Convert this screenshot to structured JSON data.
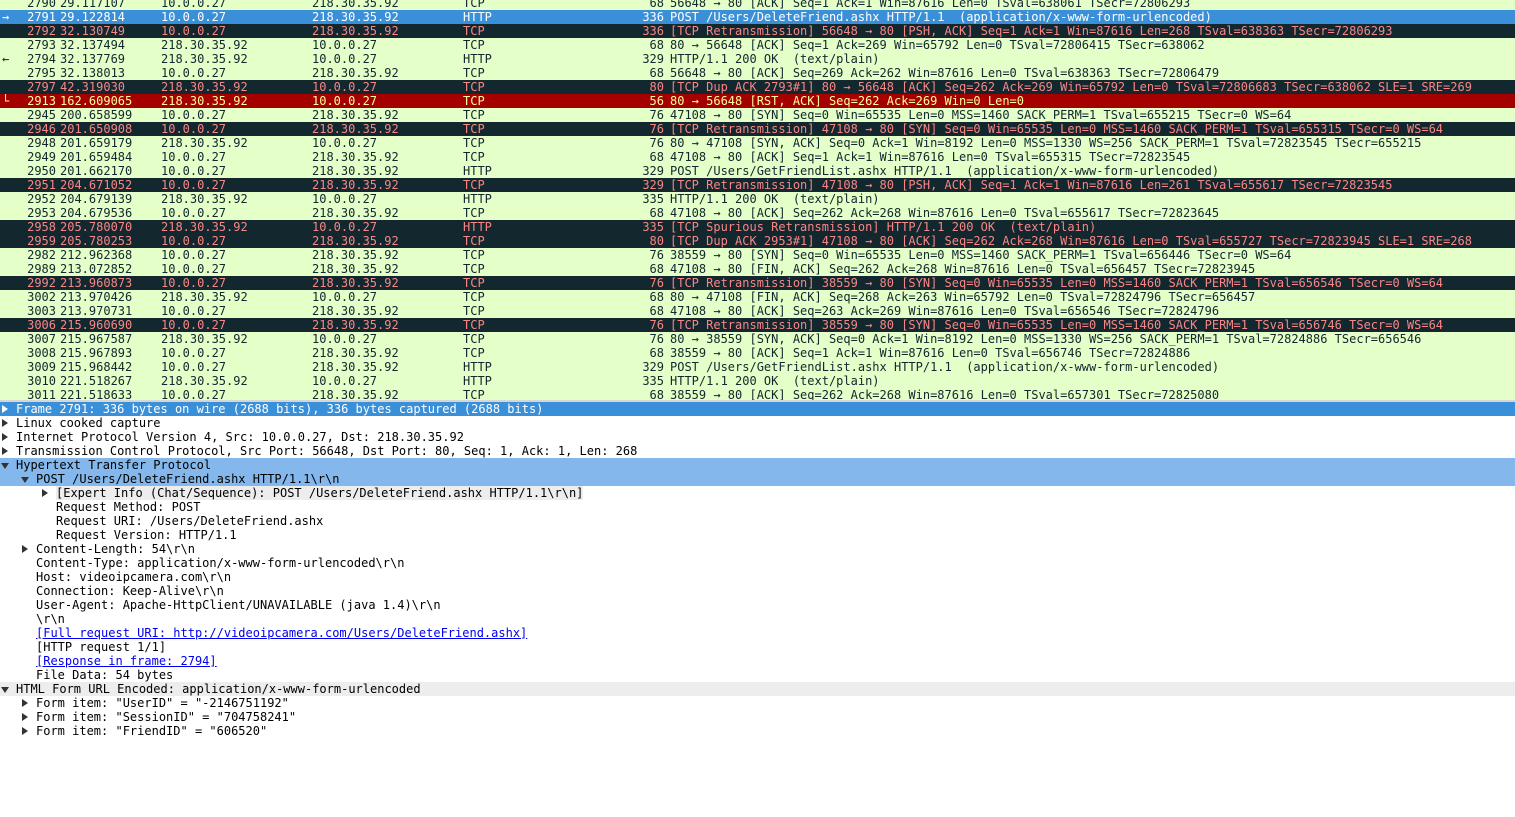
{
  "packets": [
    {
      "no": "2790",
      "time": "29.117107",
      "src": "10.0.0.27",
      "dst": "218.30.35.92",
      "proto": "TCP",
      "len": "68",
      "info": "56648 → 80 [ACK] Seq=1 Ack=1 Win=87616 Len=0 TSval=638061 TSecr=72806293",
      "style": "normal",
      "marker": ""
    },
    {
      "no": "2791",
      "time": "29.122814",
      "src": "10.0.0.27",
      "dst": "218.30.35.92",
      "proto": "HTTP",
      "len": "336",
      "info": "POST /Users/DeleteFriend.ashx HTTP/1.1  (application/x-www-form-urlencoded)",
      "style": "selected",
      "marker": "→"
    },
    {
      "no": "2792",
      "time": "32.130749",
      "src": "10.0.0.27",
      "dst": "218.30.35.92",
      "proto": "TCP",
      "len": "336",
      "info": "[TCP Retransmission] 56648 → 80 [PSH, ACK] Seq=1 Ack=1 Win=87616 Len=268 TSval=638363 TSecr=72806293",
      "style": "bad",
      "marker": ""
    },
    {
      "no": "2793",
      "time": "32.137494",
      "src": "218.30.35.92",
      "dst": "10.0.0.27",
      "proto": "TCP",
      "len": "68",
      "info": "80 → 56648 [ACK] Seq=1 Ack=269 Win=65792 Len=0 TSval=72806415 TSecr=638062",
      "style": "normal",
      "marker": ""
    },
    {
      "no": "2794",
      "time": "32.137769",
      "src": "218.30.35.92",
      "dst": "10.0.0.27",
      "proto": "HTTP",
      "len": "329",
      "info": "HTTP/1.1 200 OK  (text/plain)",
      "style": "normal",
      "marker": "←"
    },
    {
      "no": "2795",
      "time": "32.138013",
      "src": "10.0.0.27",
      "dst": "218.30.35.92",
      "proto": "TCP",
      "len": "68",
      "info": "56648 → 80 [ACK] Seq=269 Ack=262 Win=87616 Len=0 TSval=638363 TSecr=72806479",
      "style": "normal",
      "marker": ""
    },
    {
      "no": "2797",
      "time": "42.319030",
      "src": "218.30.35.92",
      "dst": "10.0.0.27",
      "proto": "TCP",
      "len": "80",
      "info": "[TCP Dup ACK 2793#1] 80 → 56648 [ACK] Seq=262 Ack=269 Win=65792 Len=0 TSval=72806683 TSecr=638062 SLE=1 SRE=269",
      "style": "bad",
      "marker": ""
    },
    {
      "no": "2913",
      "time": "162.609065",
      "src": "218.30.35.92",
      "dst": "10.0.0.27",
      "proto": "TCP",
      "len": "56",
      "info": "80 → 56648 [RST, ACK] Seq=262 Ack=269 Win=0 Len=0",
      "style": "rst",
      "marker": "└"
    },
    {
      "no": "2945",
      "time": "200.658599",
      "src": "10.0.0.27",
      "dst": "218.30.35.92",
      "proto": "TCP",
      "len": "76",
      "info": "47108 → 80 [SYN] Seq=0 Win=65535 Len=0 MSS=1460 SACK_PERM=1 TSval=655215 TSecr=0 WS=64",
      "style": "normal",
      "marker": ""
    },
    {
      "no": "2946",
      "time": "201.650908",
      "src": "10.0.0.27",
      "dst": "218.30.35.92",
      "proto": "TCP",
      "len": "76",
      "info": "[TCP Retransmission] 47108 → 80 [SYN] Seq=0 Win=65535 Len=0 MSS=1460 SACK_PERM=1 TSval=655315 TSecr=0 WS=64",
      "style": "bad",
      "marker": ""
    },
    {
      "no": "2948",
      "time": "201.659179",
      "src": "218.30.35.92",
      "dst": "10.0.0.27",
      "proto": "TCP",
      "len": "76",
      "info": "80 → 47108 [SYN, ACK] Seq=0 Ack=1 Win=8192 Len=0 MSS=1330 WS=256 SACK_PERM=1 TSval=72823545 TSecr=655215",
      "style": "normal",
      "marker": ""
    },
    {
      "no": "2949",
      "time": "201.659484",
      "src": "10.0.0.27",
      "dst": "218.30.35.92",
      "proto": "TCP",
      "len": "68",
      "info": "47108 → 80 [ACK] Seq=1 Ack=1 Win=87616 Len=0 TSval=655315 TSecr=72823545",
      "style": "normal",
      "marker": ""
    },
    {
      "no": "2950",
      "time": "201.662170",
      "src": "10.0.0.27",
      "dst": "218.30.35.92",
      "proto": "HTTP",
      "len": "329",
      "info": "POST /Users/GetFriendList.ashx HTTP/1.1  (application/x-www-form-urlencoded)",
      "style": "normal",
      "marker": ""
    },
    {
      "no": "2951",
      "time": "204.671052",
      "src": "10.0.0.27",
      "dst": "218.30.35.92",
      "proto": "TCP",
      "len": "329",
      "info": "[TCP Retransmission] 47108 → 80 [PSH, ACK] Seq=1 Ack=1 Win=87616 Len=261 TSval=655617 TSecr=72823545",
      "style": "bad",
      "marker": ""
    },
    {
      "no": "2952",
      "time": "204.679139",
      "src": "218.30.35.92",
      "dst": "10.0.0.27",
      "proto": "HTTP",
      "len": "335",
      "info": "HTTP/1.1 200 OK  (text/plain)",
      "style": "normal",
      "marker": ""
    },
    {
      "no": "2953",
      "time": "204.679536",
      "src": "10.0.0.27",
      "dst": "218.30.35.92",
      "proto": "TCP",
      "len": "68",
      "info": "47108 → 80 [ACK] Seq=262 Ack=268 Win=87616 Len=0 TSval=655617 TSecr=72823645",
      "style": "normal",
      "marker": ""
    },
    {
      "no": "2958",
      "time": "205.780070",
      "src": "218.30.35.92",
      "dst": "10.0.0.27",
      "proto": "HTTP",
      "len": "335",
      "info": "[TCP Spurious Retransmission] HTTP/1.1 200 OK  (text/plain)",
      "style": "bad",
      "marker": ""
    },
    {
      "no": "2959",
      "time": "205.780253",
      "src": "10.0.0.27",
      "dst": "218.30.35.92",
      "proto": "TCP",
      "len": "80",
      "info": "[TCP Dup ACK 2953#1] 47108 → 80 [ACK] Seq=262 Ack=268 Win=87616 Len=0 TSval=655727 TSecr=72823945 SLE=1 SRE=268",
      "style": "bad",
      "marker": ""
    },
    {
      "no": "2982",
      "time": "212.962368",
      "src": "10.0.0.27",
      "dst": "218.30.35.92",
      "proto": "TCP",
      "len": "76",
      "info": "38559 → 80 [SYN] Seq=0 Win=65535 Len=0 MSS=1460 SACK_PERM=1 TSval=656446 TSecr=0 WS=64",
      "style": "normal",
      "marker": ""
    },
    {
      "no": "2989",
      "time": "213.072852",
      "src": "10.0.0.27",
      "dst": "218.30.35.92",
      "proto": "TCP",
      "len": "68",
      "info": "47108 → 80 [FIN, ACK] Seq=262 Ack=268 Win=87616 Len=0 TSval=656457 TSecr=72823945",
      "style": "normal",
      "marker": ""
    },
    {
      "no": "2992",
      "time": "213.960873",
      "src": "10.0.0.27",
      "dst": "218.30.35.92",
      "proto": "TCP",
      "len": "76",
      "info": "[TCP Retransmission] 38559 → 80 [SYN] Seq=0 Win=65535 Len=0 MSS=1460 SACK_PERM=1 TSval=656546 TSecr=0 WS=64",
      "style": "bad",
      "marker": ""
    },
    {
      "no": "3002",
      "time": "213.970426",
      "src": "218.30.35.92",
      "dst": "10.0.0.27",
      "proto": "TCP",
      "len": "68",
      "info": "80 → 47108 [FIN, ACK] Seq=268 Ack=263 Win=65792 Len=0 TSval=72824796 TSecr=656457",
      "style": "normal",
      "marker": ""
    },
    {
      "no": "3003",
      "time": "213.970731",
      "src": "10.0.0.27",
      "dst": "218.30.35.92",
      "proto": "TCP",
      "len": "68",
      "info": "47108 → 80 [ACK] Seq=263 Ack=269 Win=87616 Len=0 TSval=656546 TSecr=72824796",
      "style": "normal",
      "marker": ""
    },
    {
      "no": "3006",
      "time": "215.960690",
      "src": "10.0.0.27",
      "dst": "218.30.35.92",
      "proto": "TCP",
      "len": "76",
      "info": "[TCP Retransmission] 38559 → 80 [SYN] Seq=0 Win=65535 Len=0 MSS=1460 SACK_PERM=1 TSval=656746 TSecr=0 WS=64",
      "style": "bad",
      "marker": ""
    },
    {
      "no": "3007",
      "time": "215.967587",
      "src": "218.30.35.92",
      "dst": "10.0.0.27",
      "proto": "TCP",
      "len": "76",
      "info": "80 → 38559 [SYN, ACK] Seq=0 Ack=1 Win=8192 Len=0 MSS=1330 WS=256 SACK_PERM=1 TSval=72824886 TSecr=656546",
      "style": "normal",
      "marker": ""
    },
    {
      "no": "3008",
      "time": "215.967893",
      "src": "10.0.0.27",
      "dst": "218.30.35.92",
      "proto": "TCP",
      "len": "68",
      "info": "38559 → 80 [ACK] Seq=1 Ack=1 Win=87616 Len=0 TSval=656746 TSecr=72824886",
      "style": "normal",
      "marker": ""
    },
    {
      "no": "3009",
      "time": "215.968442",
      "src": "10.0.0.27",
      "dst": "218.30.35.92",
      "proto": "HTTP",
      "len": "329",
      "info": "POST /Users/GetFriendList.ashx HTTP/1.1  (application/x-www-form-urlencoded)",
      "style": "normal",
      "marker": ""
    },
    {
      "no": "3010",
      "time": "221.518267",
      "src": "218.30.35.92",
      "dst": "10.0.0.27",
      "proto": "HTTP",
      "len": "335",
      "info": "HTTP/1.1 200 OK  (text/plain)",
      "style": "normal",
      "marker": ""
    },
    {
      "no": "3011",
      "time": "221.518633",
      "src": "10.0.0.27",
      "dst": "218.30.35.92",
      "proto": "TCP",
      "len": "68",
      "info": "38559 → 80 [ACK] Seq=262 Ack=268 Win=87616 Len=0 TSval=657301 TSecr=72825080",
      "style": "normal",
      "marker": ""
    }
  ],
  "details": [
    {
      "text": "Frame 2791: 336 bytes on wire (2688 bits), 336 bytes captured (2688 bits)",
      "level": 0,
      "tw": "closed",
      "row": "sel-frame",
      "link": false,
      "boxed": false
    },
    {
      "text": "Linux cooked capture",
      "level": 0,
      "tw": "closed",
      "row": "",
      "link": false,
      "boxed": false
    },
    {
      "text": "Internet Protocol Version 4, Src: 10.0.0.27, Dst: 218.30.35.92",
      "level": 0,
      "tw": "closed",
      "row": "",
      "link": false,
      "boxed": false
    },
    {
      "text": "Transmission Control Protocol, Src Port: 56648, Dst Port: 80, Seq: 1, Ack: 1, Len: 268",
      "level": 0,
      "tw": "closed",
      "row": "",
      "link": false,
      "boxed": false
    },
    {
      "text": "Hypertext Transfer Protocol",
      "level": 0,
      "tw": "open",
      "row": "hl",
      "link": false,
      "boxed": false
    },
    {
      "text": "POST /Users/DeleteFriend.ashx HTTP/1.1\\r\\n",
      "level": 1,
      "tw": "open",
      "row": "hl",
      "link": false,
      "boxed": false
    },
    {
      "text": "[Expert Info (Chat/Sequence): POST /Users/DeleteFriend.ashx HTTP/1.1\\r\\n]",
      "level": 2,
      "tw": "closed",
      "row": "",
      "link": false,
      "boxed": true
    },
    {
      "text": "Request Method: POST",
      "level": 2,
      "tw": "",
      "row": "",
      "link": false,
      "boxed": false
    },
    {
      "text": "Request URI: /Users/DeleteFriend.ashx",
      "level": 2,
      "tw": "",
      "row": "",
      "link": false,
      "boxed": false
    },
    {
      "text": "Request Version: HTTP/1.1",
      "level": 2,
      "tw": "",
      "row": "",
      "link": false,
      "boxed": false
    },
    {
      "text": "Content-Length: 54\\r\\n",
      "level": 1,
      "tw": "closed",
      "row": "",
      "link": false,
      "boxed": false
    },
    {
      "text": "Content-Type: application/x-www-form-urlencoded\\r\\n",
      "level": 1,
      "tw": "",
      "row": "",
      "link": false,
      "boxed": false
    },
    {
      "text": "Host: videoipcamera.com\\r\\n",
      "level": 1,
      "tw": "",
      "row": "",
      "link": false,
      "boxed": false
    },
    {
      "text": "Connection: Keep-Alive\\r\\n",
      "level": 1,
      "tw": "",
      "row": "",
      "link": false,
      "boxed": false
    },
    {
      "text": "User-Agent: Apache-HttpClient/UNAVAILABLE (java 1.4)\\r\\n",
      "level": 1,
      "tw": "",
      "row": "",
      "link": false,
      "boxed": false
    },
    {
      "text": "\\r\\n",
      "level": 1,
      "tw": "",
      "row": "",
      "link": false,
      "boxed": false
    },
    {
      "text": "[Full request URI: http://videoipcamera.com/Users/DeleteFriend.ashx]",
      "level": 1,
      "tw": "",
      "row": "",
      "link": true,
      "boxed": false
    },
    {
      "text": "[HTTP request 1/1]",
      "level": 1,
      "tw": "",
      "row": "",
      "link": false,
      "boxed": false
    },
    {
      "text": "[Response in frame: 2794]",
      "level": 1,
      "tw": "",
      "row": "",
      "link": true,
      "boxed": false
    },
    {
      "text": "File Data: 54 bytes",
      "level": 1,
      "tw": "",
      "row": "",
      "link": false,
      "boxed": false
    },
    {
      "text": "HTML Form URL Encoded: application/x-www-form-urlencoded",
      "level": 0,
      "tw": "open",
      "row": "grey",
      "link": false,
      "boxed": false
    },
    {
      "text": "Form item: \"UserID\" = \"-2146751192\"",
      "level": 1,
      "tw": "closed",
      "row": "",
      "link": false,
      "boxed": false
    },
    {
      "text": "Form item: \"SessionID\" = \"704758241\"",
      "level": 1,
      "tw": "closed",
      "row": "",
      "link": false,
      "boxed": false
    },
    {
      "text": "Form item: \"FriendID\" = \"606520\"",
      "level": 1,
      "tw": "closed",
      "row": "",
      "link": false,
      "boxed": false
    }
  ]
}
